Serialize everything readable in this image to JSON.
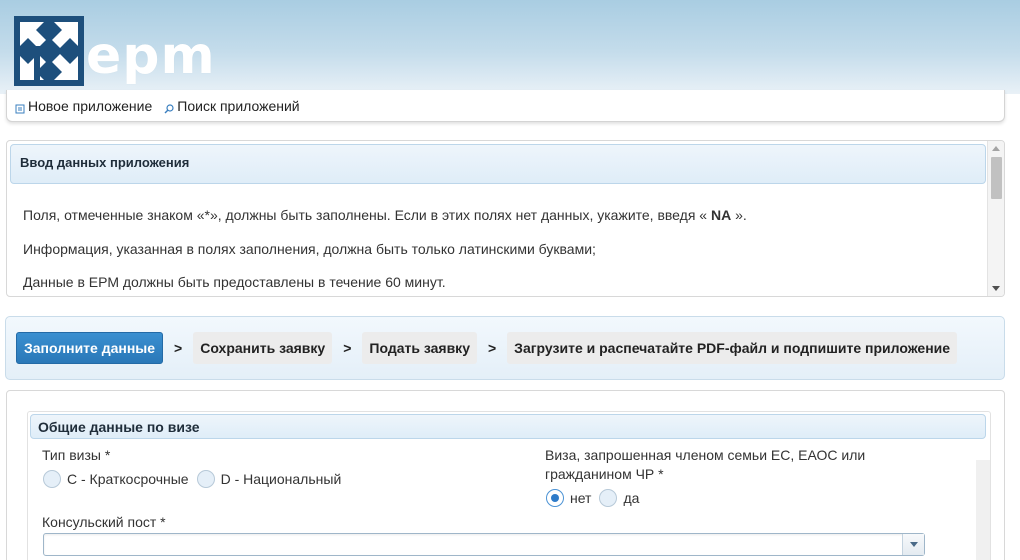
{
  "brand": {
    "wordmark": "epm"
  },
  "nav": {
    "items": [
      {
        "label": "Новое приложение",
        "icon": "new-document-icon"
      },
      {
        "label": "Поиск приложений",
        "icon": "search-icon"
      }
    ]
  },
  "info": {
    "title": "Ввод данных приложения",
    "line1_prefix": "Поля, отмеченные знаком «*», должны быть заполнены. Если в этих полях нет данных, укажите, введя « ",
    "line1_code": "NA",
    "line1_suffix": " ».",
    "line2": "Информация, указанная в полях заполнения, должна быть только латинскими буквами;",
    "line3": "Данные в ЕРМ должны быть предоставлены в течение 60 минут."
  },
  "steps": {
    "items": [
      {
        "label": "Заполните данные",
        "active": true
      },
      {
        "label": "Сохранить заявку",
        "active": false
      },
      {
        "label": "Подать заявку",
        "active": false
      },
      {
        "label": "Загрузите и распечатайте PDF-файл и подпишите приложение",
        "active": false
      }
    ],
    "separator": ">"
  },
  "form": {
    "section_title": "Общие данные по визе",
    "visa_type": {
      "label": "Тип визы *",
      "options": [
        "C - Краткосрочные",
        "D - Национальный"
      ],
      "selected": null
    },
    "family_member": {
      "label_line1": "Виза, запрошенная членом семьи ЕС, ЕАОС или",
      "label_line2": "гражданином ЧР *",
      "options": [
        "нет",
        "да"
      ],
      "selected": "нет"
    },
    "consulate": {
      "label": "Консульский пост *",
      "value": ""
    }
  },
  "colors": {
    "accent": "#2a78b8",
    "header_top": "#a9cde2",
    "logo_dark": "#1d4f7c",
    "panel_header": "#dfedf8"
  }
}
